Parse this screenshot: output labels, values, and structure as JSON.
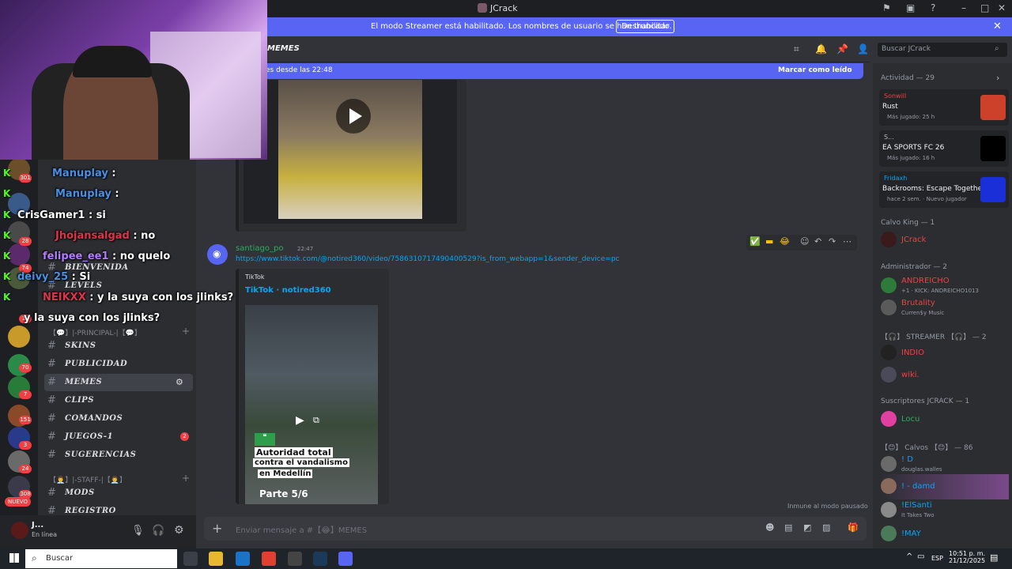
{
  "window": {
    "title": "JCrack"
  },
  "banner": {
    "text": "El modo Streamer está habilitado. Los nombres de usuario se han truncado.",
    "button": "Deshabilitar"
  },
  "header": {
    "channel": "MEMES",
    "search_placeholder": "Buscar JCrack"
  },
  "new_messages": {
    "text": "es desde las 22:48",
    "mark_read": "Marcar como leído"
  },
  "server_badges": [
    "301",
    "28",
    "74",
    "1k",
    "70",
    "7",
    "151",
    "3",
    "24",
    "308"
  ],
  "nuevo_label": "NUEVO",
  "categories": {
    "principal": "【💬】|-PRINCIPAL-|【💬】",
    "staff": "【👨‍💼】|-STAFF-|【👨‍💼】"
  },
  "channels": [
    {
      "name": "BIENVENIDA",
      "prefix": "【👋】"
    },
    {
      "name": "LEVELS",
      "prefix": "【📊】"
    },
    {
      "name": "SKINS",
      "prefix": "【😊】"
    },
    {
      "name": "PUBLICIDAD",
      "prefix": "【📢】"
    },
    {
      "name": "MEMES",
      "prefix": "【😂】",
      "active": true
    },
    {
      "name": "CLIPS",
      "prefix": "【🎬】"
    },
    {
      "name": "COMANDOS",
      "prefix": "【🤖】"
    },
    {
      "name": "JUEGOS-1",
      "prefix": "【🎮】",
      "badge": "2"
    },
    {
      "name": "SUGERENCIAS",
      "prefix": "【📋】"
    },
    {
      "name": "MODS",
      "prefix": "【👮】"
    },
    {
      "name": "REGISTRO",
      "prefix": "【📘】"
    }
  ],
  "user_panel": {
    "name": "J...",
    "status": "En línea"
  },
  "message": {
    "author": "santiago_po",
    "time": "22:47",
    "link": "https://www.tiktok.com/@notired360/video/7586310717490400529?is_from_webapp=1&sender_device=pc",
    "embed_provider": "TikTok",
    "embed_title": "TikTok · notired360",
    "video_caption_1": "Autoridad total",
    "video_caption_2": "contra el vandalismo",
    "video_caption_3": "en Medellín",
    "video_part": "Parte 5/6"
  },
  "immune_text": "Inmune al modo pausado",
  "composer": {
    "placeholder": "Enviar mensaje a #【😂】MEMES"
  },
  "members": {
    "activity_header": "Actividad — 29",
    "activities": [
      {
        "user": "Sonwill",
        "game": "Rust",
        "sub": "Más jugado: 25 h",
        "logo_color": "#cd412b"
      },
      {
        "user": "S...",
        "game": "EA SPORTS FC 26",
        "sub": "Más jugado: 16 h",
        "logo_color": "#000000"
      },
      {
        "user": "Fridaxh",
        "game": "Backrooms: Escape Together",
        "sub": "hace 2 sem. · Nuevo jugador",
        "logo_color": "#1a2fd8"
      }
    ],
    "groups": [
      {
        "header": "Calvo King — 1",
        "rows": [
          {
            "name": "JCrack",
            "sub": "",
            "color": "#f23f43"
          }
        ]
      },
      {
        "header": "Administrador — 2",
        "rows": [
          {
            "name": "ANDREICHO",
            "sub": "+1 · KICK: ANDREICHO1013",
            "color": "#f23f43"
          },
          {
            "name": "Brutality",
            "sub": "Curren$y Music",
            "color": "#f23f43"
          }
        ]
      },
      {
        "header": "【🎧】 STREAMER 【🎧】 — 2",
        "rows": [
          {
            "name": "INDIO",
            "sub": "",
            "color": "#f23f43"
          },
          {
            "name": "wiki.",
            "sub": "",
            "color": "#f23f43"
          }
        ]
      },
      {
        "header": "Suscriptores JCRACK — 1",
        "rows": [
          {
            "name": "Locu",
            "sub": "",
            "color": "#3ba55d"
          }
        ]
      },
      {
        "header": "【😊】 Calvos 【😊】 — 86",
        "rows": [
          {
            "name": "! D",
            "sub": "douglas.walles",
            "color": "#00a8fc"
          },
          {
            "name": "! - damd",
            "sub": "",
            "color": "#00a8fc"
          },
          {
            "name": "!ElSanti",
            "sub": "It Takes Two",
            "color": "#00a8fc"
          },
          {
            "name": "!MAY",
            "sub": "",
            "color": "#00a8fc"
          }
        ]
      }
    ]
  },
  "chat_overlay": [
    {
      "user": "Manuplay",
      "msg": ":",
      "color": "#4a90e2"
    },
    {
      "user": "Manuplay",
      "msg": ":",
      "color": "#4a90e2"
    },
    {
      "user": "CrisGamer1",
      "msg": ": si",
      "color": "#ffffff"
    },
    {
      "user": "Jhojansalgad",
      "msg": ": no",
      "color": "#e0334a"
    },
    {
      "user": "felipee_ee1",
      "msg": ": no quelo",
      "color": "#b57bff"
    },
    {
      "user": "deivy_25",
      "msg": ": Si",
      "color": "#4a90e2"
    },
    {
      "user": "NEIKXX",
      "msg": ": y la suya con los jlinks?",
      "color": "#e0334a"
    },
    {
      "user": "",
      "msg": "y la suya con los jlinks?",
      "color": "#ffffff"
    }
  ],
  "taskbar": {
    "search": "Buscar",
    "lang": "ESP",
    "time": "10:51 p. m.",
    "date": "21/12/2025"
  }
}
